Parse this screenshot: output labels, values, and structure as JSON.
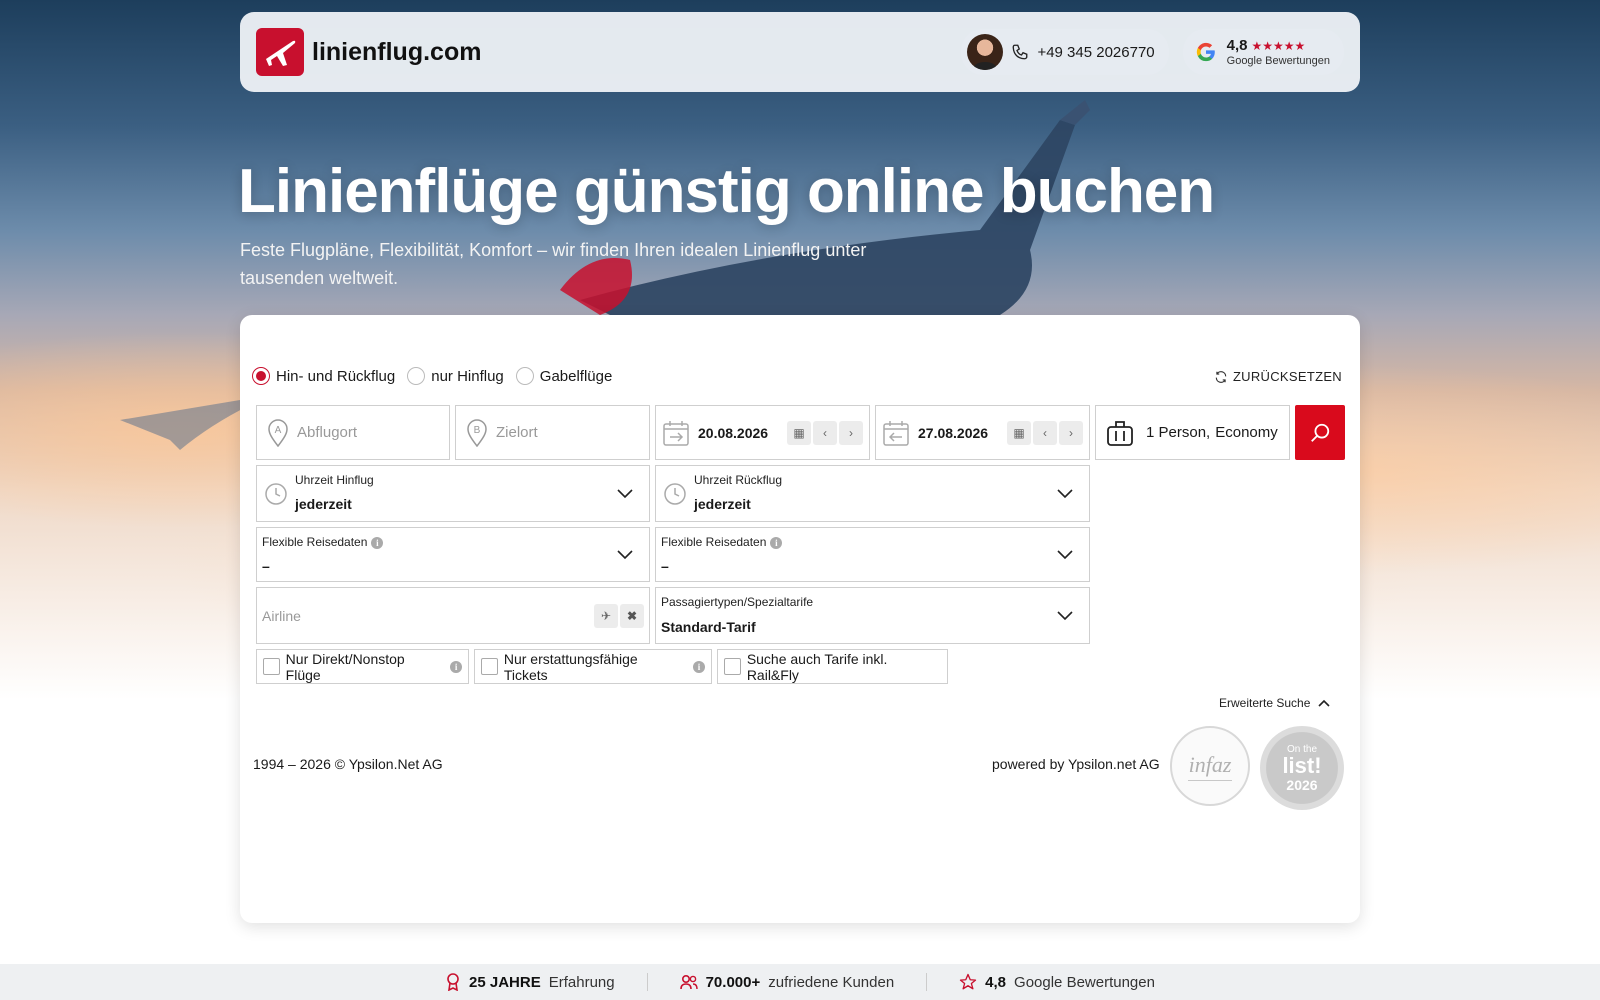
{
  "header": {
    "logo_text": "linienflug.com",
    "phone": "+49 345 2026770",
    "rating_value": "4,8",
    "rating_label": "Google Bewertungen",
    "brand_color": "#c8102e"
  },
  "hero": {
    "title": "Linienflüge günstig online buchen",
    "subtitle": "Feste Flugpläne, Flexibilität, Komfort – wir finden Ihren idealen Linienflug unter tausenden weltweit."
  },
  "search": {
    "trip_types": [
      {
        "label": "Hin- und Rückflug",
        "selected": true
      },
      {
        "label": "nur Hinflug",
        "selected": false
      },
      {
        "label": "Gabelflüge",
        "selected": false
      }
    ],
    "reset_label": "ZURÜCKSETZEN",
    "origin_placeholder": "Abflugort",
    "destination_placeholder": "Zielort",
    "depart_date": "20.08.2026",
    "return_date": "27.08.2026",
    "passengers": "1 Person,",
    "cabin": "Economy",
    "time_outbound_label": "Uhrzeit Hinflug",
    "time_outbound_value": "jederzeit",
    "time_return_label": "Uhrzeit Rückflug",
    "time_return_value": "jederzeit",
    "flex_label_1": "Flexible Reisedaten",
    "flex_value_1": "–",
    "flex_label_2": "Flexible Reisedaten",
    "flex_value_2": "–",
    "airline_placeholder": "Airline",
    "pax_types_label": "Passagiertypen/Spezialtarife",
    "pax_types_value": "Standard-Tarif",
    "checkboxes": [
      {
        "label": "Nur Direkt/Nonstop Flüge",
        "checked": false
      },
      {
        "label": "Nur erstattungsfähige Tickets",
        "checked": false
      },
      {
        "label": "Suche auch Tarife inkl. Rail&Fly",
        "checked": false
      }
    ],
    "advanced_label": "Erweiterte Suche",
    "accent_color": "#d90a1c"
  },
  "footer": {
    "copyright": "1994 – 2026 © Ypsilon.Net AG",
    "powered_by": "powered by Ypsilon.net AG",
    "seal1_text": "infaz",
    "seal2_top": "On the",
    "seal2_mid": "list!",
    "seal2_year": "2026"
  },
  "stats": [
    {
      "bold": "25 JAHRE",
      "text": "Erfahrung",
      "icon": "award-icon"
    },
    {
      "bold": "70.000+",
      "text": "zufriedene Kunden",
      "icon": "users-icon"
    },
    {
      "bold": "4,8",
      "text": "Google Bewertungen",
      "icon": "star-icon"
    }
  ]
}
